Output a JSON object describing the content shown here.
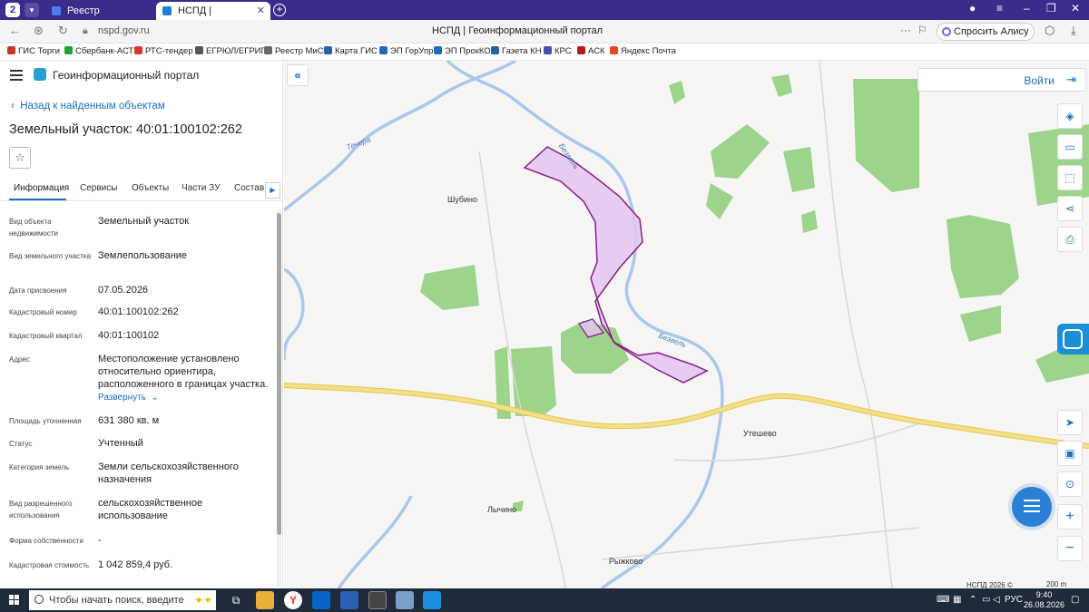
{
  "browser": {
    "tab_count": "2",
    "tabs": [
      {
        "title": "Реестр извещений",
        "active": false
      },
      {
        "title": "НСПД | Геоинформаци",
        "active": true
      }
    ],
    "url": "nspd.gov.ru",
    "page_title": "НСПД | Геоинформационный портал",
    "alice_button": "Спросить Алису AI",
    "bookmarks": [
      "ГИС Торги",
      "Сбербанк-АСТ",
      "РТС-тендер",
      "ЕГРЮЛ/ЕГРИП",
      "Реестр МиС",
      "Карта ГИС",
      "ЭП ГорУпр",
      "ЭП ПрокКО",
      "Газета КН",
      "КРС",
      "АСК",
      "Яндекс Почта"
    ]
  },
  "panel": {
    "portal_title": "Геоинформационный портал",
    "back_link": "Назад к найденным объектам",
    "parcel_title": "Земельный участок: 40:01:100102:262",
    "tabs": [
      "Информация",
      "Сервисы",
      "Объекты",
      "Части ЗУ",
      "Состав"
    ],
    "expand_link": "Развернуть",
    "attributes": [
      {
        "label": "Вид объекта недвижимости",
        "value": "Земельный участок"
      },
      {
        "label": "Вид земельного участка",
        "value": "Землепользование"
      },
      {
        "label": "Дата присвоения",
        "value": "07.05.2026"
      },
      {
        "label": "Кадастровый номер",
        "value": "40:01:100102:262"
      },
      {
        "label": "Кадастровый квартал",
        "value": "40:01:100102"
      },
      {
        "label": "Адрес",
        "value": "Местоположение установлено относительно ориентира, расположенного в границах участка."
      },
      {
        "label": "Площадь уточненная",
        "value": "631 380 кв. м"
      },
      {
        "label": "Статус",
        "value": "Учтенный"
      },
      {
        "label": "Категория земель",
        "value": "Земли сельскохозяйственного назначения"
      },
      {
        "label": "Вид разрешенного использования",
        "value": "сельскохозяйственное использование"
      },
      {
        "label": "Форма собственности",
        "value": "-"
      },
      {
        "label": "Кадастровая стоимость",
        "value": "1 042 859,4 руб."
      }
    ]
  },
  "map": {
    "login_label": "Войти",
    "places": [
      "Шубино",
      "Утешево",
      "Лычино",
      "Рыжково"
    ],
    "rivers": [
      "Течера",
      "Безвель",
      "Безвель"
    ],
    "copyright": "НСПД 2026 ©",
    "scale": "200 m",
    "colors": {
      "forest": "#9bd48a",
      "parcel_fill": "#e3c4ef",
      "parcel_stroke": "#8a1c8a",
      "water": "#a9c8ee",
      "road": "#f2df8e"
    }
  },
  "taskbar": {
    "search_placeholder": "Чтобы начать поиск, введите",
    "language": "РУС",
    "time": "9:40",
    "date": "26.08.2026"
  }
}
